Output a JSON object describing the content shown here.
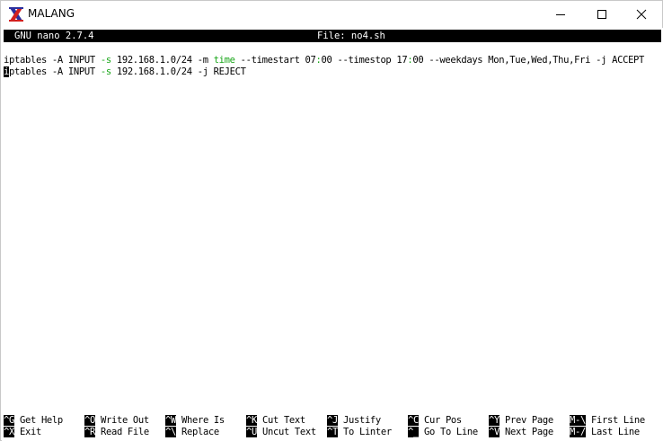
{
  "window": {
    "title": "MALANG",
    "controls": {
      "minimize": "minimize",
      "maximize": "maximize",
      "close": "close"
    }
  },
  "nano": {
    "version": "GNU nano 2.7.4",
    "file": "File: no4.sh"
  },
  "editor": {
    "line1": {
      "a": "iptables -A INPUT ",
      "s_flag": "-s",
      "b": " 192.168.1.0/24 -m ",
      "time_kw": "time",
      "c": " --timestart 07",
      "colon1": ":",
      "d": "00 --timestop 17",
      "colon2": ":",
      "e": "00 --weekdays Mon,Tue,Wed,Thu,Fri -j ACCEPT"
    },
    "line2": {
      "cursor_char": "i",
      "a": "ptables -A INPUT ",
      "s_flag": "-s",
      "b": " 192.168.1.0/24 -j REJECT"
    }
  },
  "shortcuts": [
    {
      "key": "^G",
      "label": " Get Help"
    },
    {
      "key": "^X",
      "label": " Exit"
    },
    {
      "key": "^O",
      "label": " Write Out"
    },
    {
      "key": "^R",
      "label": " Read File"
    },
    {
      "key": "^W",
      "label": " Where Is"
    },
    {
      "key": "^\\",
      "label": " Replace"
    },
    {
      "key": "^K",
      "label": " Cut Text"
    },
    {
      "key": "^U",
      "label": " Uncut Text"
    },
    {
      "key": "^J",
      "label": " Justify"
    },
    {
      "key": "^T",
      "label": " To Linter"
    },
    {
      "key": "^C",
      "label": " Cur Pos"
    },
    {
      "key": "^_",
      "label": " Go To Line"
    },
    {
      "key": "^Y",
      "label": " Prev Page"
    },
    {
      "key": "^V",
      "label": " Next Page"
    },
    {
      "key": "M-\\",
      "label": " First Line"
    },
    {
      "key": "M-/",
      "label": " Last Line"
    }
  ],
  "colors": {
    "keyword": "#19a619",
    "header_bg": "#000000",
    "header_fg": "#ffffff"
  },
  "icons": {
    "app": "x-app-icon",
    "minimize": "minimize-icon",
    "maximize": "maximize-icon",
    "close": "close-icon"
  }
}
